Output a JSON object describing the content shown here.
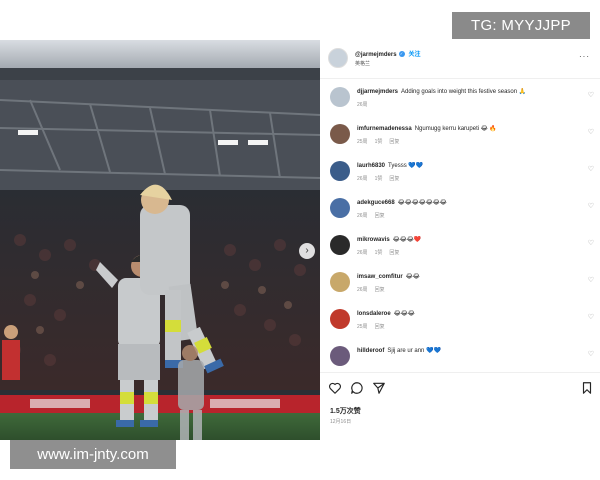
{
  "watermarks": {
    "top": "TG: MYYJJPP",
    "bottom": "www.im-jnty.com"
  },
  "post": {
    "header": {
      "username": "@jarmejmders",
      "follow_label": "关注",
      "location": "英格兰",
      "more_label": "···"
    },
    "comments": [
      {
        "user": "djjarmejmders",
        "text": "Adding goals into weight this festive season 🙏",
        "meta": [
          "26周"
        ],
        "avatar_color": "#b9c4cf"
      },
      {
        "user": "imfurnemadenessa",
        "text": "Ngumugg kerru karupeti 😂 🔥",
        "meta": [
          "25周",
          "1赞",
          "回复"
        ],
        "avatar_color": "#7a5a4a"
      },
      {
        "user": "laurh6830",
        "text": "Tyesss 💙💙",
        "meta": [
          "26周",
          "1赞",
          "回复"
        ],
        "avatar_color": "#3b5d8a"
      },
      {
        "user": "adekguce668",
        "text": "😂😂😂😂😂😂😂",
        "meta": [
          "26周",
          "回复"
        ],
        "avatar_color": "#4a6fa5"
      },
      {
        "user": "mikrowavis",
        "text": "😂😂😂❤️",
        "meta": [
          "26周",
          "1赞",
          "回复"
        ],
        "avatar_color": "#2a2a2a"
      },
      {
        "user": "imsaw_comfitur",
        "text": "😂😂",
        "meta": [
          "26周",
          "回复"
        ],
        "avatar_color": "#c8a86a"
      },
      {
        "user": "lonsdaleroe",
        "text": "😂😂😂",
        "meta": [
          "25周",
          "回复"
        ],
        "avatar_color": "#c0392b"
      },
      {
        "user": "hillderoof",
        "text": "Sjij are ur ann 💙💙",
        "meta": [],
        "avatar_color": "#6b5b7b"
      }
    ],
    "actions": {
      "likes": "1.5万次赞",
      "date": "12月16日"
    }
  },
  "colors": {
    "accent": "#0095f6",
    "verified": "#3897f0",
    "watermark_bg": "#8a8a8a"
  },
  "icons": [
    "heart-icon",
    "comment-icon",
    "share-icon",
    "bookmark-icon",
    "next-arrow-icon",
    "verified-icon"
  ]
}
